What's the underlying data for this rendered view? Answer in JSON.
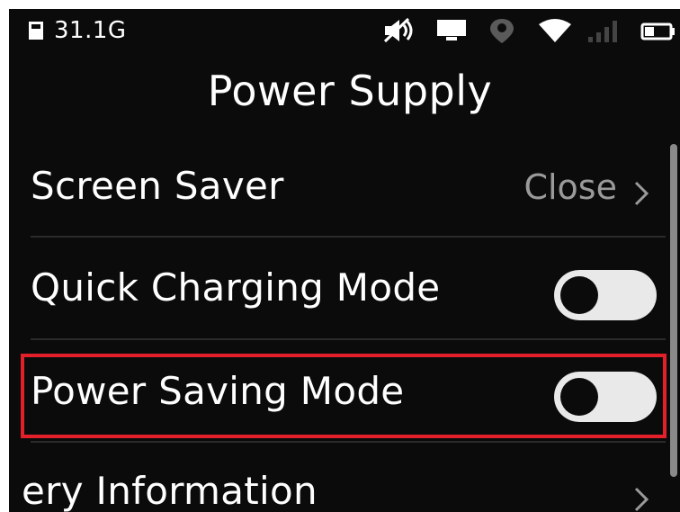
{
  "status_bar": {
    "storage": "31.1G",
    "icons": [
      "sd-card-icon",
      "mute-icon",
      "screen-icon",
      "location-icon",
      "wifi-icon",
      "signal-icon",
      "battery-icon"
    ]
  },
  "header": {
    "title": "Power Supply"
  },
  "settings": [
    {
      "label": "Screen Saver",
      "value": "Close",
      "type": "link"
    },
    {
      "label": "Quick Charging Mode",
      "type": "toggle",
      "enabled": false
    },
    {
      "label": "Power Saving Mode",
      "type": "toggle",
      "enabled": false,
      "highlighted": true
    },
    {
      "label": "ery Information",
      "type": "link"
    }
  ],
  "colors": {
    "background": "#0b0b0b",
    "text": "#ffffff",
    "value_text": "#9a9a9a",
    "highlight": "#e3202a",
    "toggle_track": "#e9e9e9"
  }
}
